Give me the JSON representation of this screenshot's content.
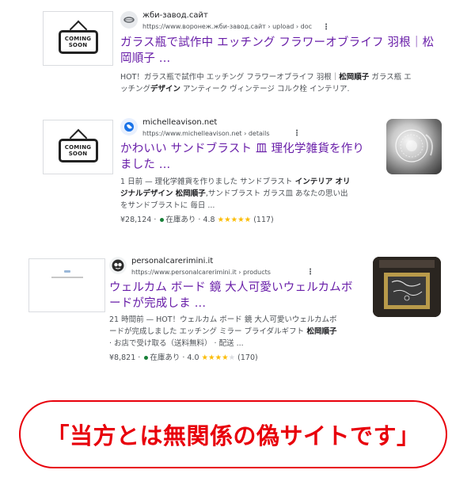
{
  "results": [
    {
      "site_name": "жби-завод.сайт",
      "url": "https://www.воронеж.жби-завод.сайт › upload › doc",
      "title_line1": "ガラス瓶で試作中 エッチング フラワーオブライフ 羽根｜松",
      "title_line2": "岡順子 ...",
      "snippet_line1": "HOT！ガラス瓶で試作中 エッチング フラワーオブライフ 羽根｜",
      "snippet_line1_bold": "松岡順子",
      "snippet_line1_tail": " ガラス瓶 エ",
      "snippet_line2_a": "ッチング",
      "snippet_line2_bold": "デザイン",
      "snippet_line2_tail": " アンティーク ヴィンテージ コルク栓 インテリア.",
      "thumb_text_1": "COMING",
      "thumb_text_2": "SOON",
      "favicon": "globe-disc-icon"
    },
    {
      "site_name": "michelleavison.net",
      "url": "https://www.michelleavison.net › details",
      "title_line1": "かわいい サンドブラスト 皿 理化学雑貨を作り",
      "title_line2": "ました ...",
      "snippet_line1_a": "1 日前 — 理化学雑貨を作りました サンドブラスト",
      "snippet_line1_bold": " インテリア オリ",
      "snippet_line2_bold": "ジナルデザイン 松岡順子",
      "snippet_line2_tail": ",サンドブラスト ガラス皿 あなたの思い出",
      "snippet_line3": "をサンドブラストに 毎日 ...",
      "price": "¥28,124",
      "stock": "在庫あり",
      "rating": "4.8",
      "stars_on": 5,
      "reviews": "(117)",
      "thumb_text_1": "COMING",
      "thumb_text_2": "SOON",
      "favicon": "blue-globe-icon"
    },
    {
      "site_name": "personalcarerimini.it",
      "url": "https://www.personalcarerimini.it › products",
      "title_line1": "ウェルカム ボード 鏡 大人可愛いウェルカムボ",
      "title_line2": "ードが完成しま ...",
      "snippet_line1": "21 時間前 — HOT！ウェルカム ボード 鏡 大人可愛いウェルカムボ",
      "snippet_line2_a": "ードが完成しました エッチング ミラー ブライダルギフト",
      "snippet_line2_bold": " 松岡順子",
      "snippet_line3": "· お店で受け取る（送料無料） · 配送 ...",
      "price": "¥8,821",
      "stock": "在庫あり",
      "rating": "4.0",
      "stars_on": 4,
      "reviews": "(170)",
      "favicon": "dark-circle-icon"
    }
  ],
  "callout": {
    "text": "「当方とは無関係の偽サイトです」",
    "color": "#e8000b"
  },
  "colors": {
    "title": "#681da8",
    "star": "#fbbc04",
    "stock_dot": "#188038"
  }
}
